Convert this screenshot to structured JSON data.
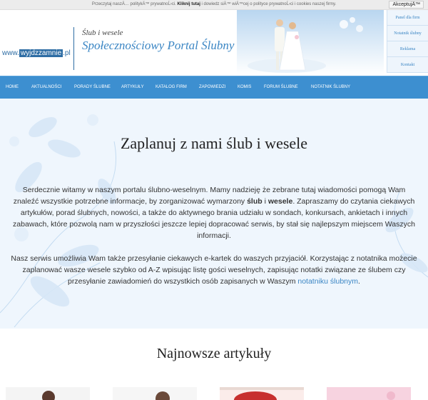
{
  "cookie": {
    "text_before": "Przeczytaj naszÄ… politykÄ™ prywatnoĹ›ci.",
    "link_label": "Kliknij tutaj",
    "text_after": "i dowiedz siÄ™ wiÄ™cej o polityce prywatnoĹ›ci i cookies naszej firmy.",
    "accept_label": "AkceptujÄ™"
  },
  "header": {
    "logo_prefix": "www.",
    "logo_highlight": "wyjdzzamnie",
    "logo_suffix": ".pl",
    "tagline": "Ślub i wesele",
    "portal_title": "Społecznościowy Portal Ślubny"
  },
  "side_links": [
    "Panel dla firm",
    "Notatnik ślubny",
    "Reklama",
    "Kontakt"
  ],
  "nav": [
    "HOME",
    "AKTUALNOŚCI",
    "PORADY ŚLUBNE",
    "ARTYKUŁY",
    "KATALOG FIRM",
    "ZAPOWIEDZI",
    "KOMIS",
    "FORUM ŚLUBNE",
    "NOTATNIK ŚLUBNY"
  ],
  "hero": {
    "title": "Zaplanuj z nami ślub i wesele",
    "p1_a": "Serdecznie witamy w naszym portalu ślubno-weselnym. Mamy nadzieję że zebrane tutaj wiadomości pomogą Wam znaleźć wszystkie potrzebne informacje, by zorganizować wymarzony ",
    "p1_b1": "ślub",
    "p1_c": " i ",
    "p1_b2": "wesele",
    "p1_d": ". Zapraszamy do czytania ciekawych artykułów, porad ślubnych, nowości, a także do aktywnego brania udziału w sondach, konkursach, ankietach i innych zabawach, które pozwolą nam w przyszłości jeszcze lepiej dopracować serwis, by stał się najlepszym miejscem Waszych informacji.",
    "p2_a": "Nasz serwis umożliwia Wam także przesyłanie ciekawych e-kartek do waszych przyjaciół. Korzystając z notatnika możecie zaplanować wasze wesele szybko od A-Z wpisując listę gości weselnych, zapisując notatki związane ze ślubem czy przesyłanie zawiadomień do wszystkich osób zapisanych w Waszym ",
    "p2_link": "notatniku ślubnym",
    "p2_end": "."
  },
  "articles": {
    "title": "Najnowsze artykuły"
  },
  "colors": {
    "nav_bg": "#3d8fd0",
    "accent": "#3b86c4",
    "hero_bg": "#eff6fd"
  }
}
